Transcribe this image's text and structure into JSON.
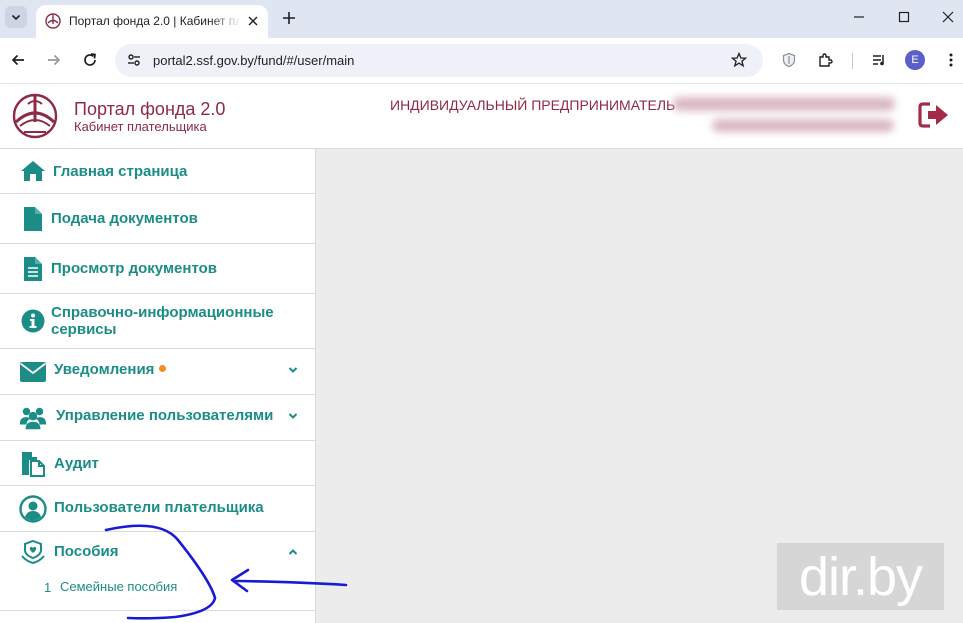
{
  "browser": {
    "tab_title": "Портал фонда 2.0 | Кабинет плательщика",
    "url": "portal2.ssf.gov.by/fund/#/user/main",
    "profile_initial": "E"
  },
  "header": {
    "title": "Портал фонда 2.0",
    "subtitle": "Кабинет плательщика",
    "user_type": "ИНДИВИДУАЛЬНЫЙ ПРЕДПРИНИМАТЕЛЬ"
  },
  "sidebar": {
    "items": [
      {
        "label": "Главная страница",
        "icon": "home-icon"
      },
      {
        "label": "Подача документов",
        "icon": "document-icon"
      },
      {
        "label": "Просмотр документов",
        "icon": "document-list-icon"
      },
      {
        "label": "Справочно-информационные сервисы",
        "icon": "info-icon"
      },
      {
        "label": "Уведомления",
        "icon": "envelope-icon",
        "has_badge": true,
        "expanded": false
      },
      {
        "label": "Управление пользователями",
        "icon": "users-icon",
        "expanded": false
      },
      {
        "label": "Аудит",
        "icon": "audit-icon"
      },
      {
        "label": "Пользователи плательщика",
        "icon": "user-circle-icon"
      },
      {
        "label": "Пособия",
        "icon": "care-icon",
        "expanded": true,
        "subitems": [
          {
            "number": "1",
            "label": "Семейные пособия"
          }
        ]
      }
    ]
  },
  "watermark": "dir.by",
  "colors": {
    "accent": "#1c8d86",
    "brand": "#8e2a45",
    "badge": "#f28c28",
    "annotation": "#1a1ad6"
  }
}
